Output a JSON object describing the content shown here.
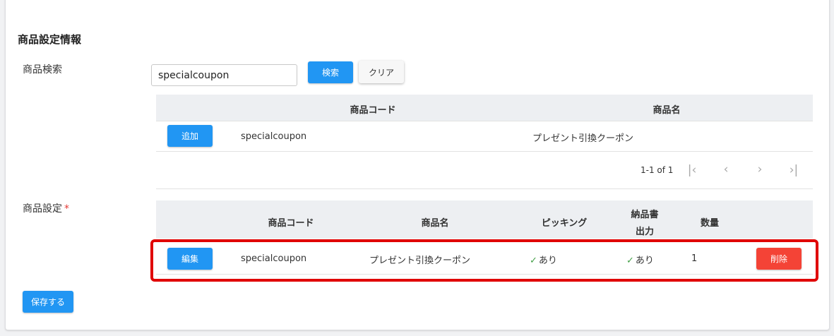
{
  "section_title": "商品設定情報",
  "search": {
    "label": "商品検索",
    "value": "specialcoupon",
    "search_button": "検索",
    "clear_button": "クリア"
  },
  "search_results": {
    "columns": [
      "商品コード",
      "商品名"
    ],
    "rows": [
      {
        "add_button": "追加",
        "code": "specialcoupon",
        "name": "プレゼント引換クーポン"
      }
    ],
    "pagination": {
      "range": "1-1 of 1"
    }
  },
  "product_settings": {
    "label": "商品設定",
    "required_mark": "*",
    "columns": {
      "code": "商品コード",
      "name": "商品名",
      "picking": "ピッキング",
      "invoice_line1": "納品書",
      "invoice_line2": "出力",
      "quantity": "数量"
    },
    "rows": [
      {
        "edit_button": "編集",
        "code": "specialcoupon",
        "name": "プレゼント引換クーポン",
        "picking": "あり",
        "invoice": "あり",
        "quantity": "1",
        "delete_button": "削除"
      }
    ]
  },
  "save_button": "保存する",
  "colors": {
    "primary": "#2196f3",
    "danger": "#f44336",
    "highlight": "#e00000",
    "check": "#43a047"
  },
  "icons": {
    "check": "check-icon",
    "first_page": "first-page-icon",
    "prev_page": "chevron-left-icon",
    "next_page": "chevron-right-icon",
    "last_page": "last-page-icon"
  }
}
